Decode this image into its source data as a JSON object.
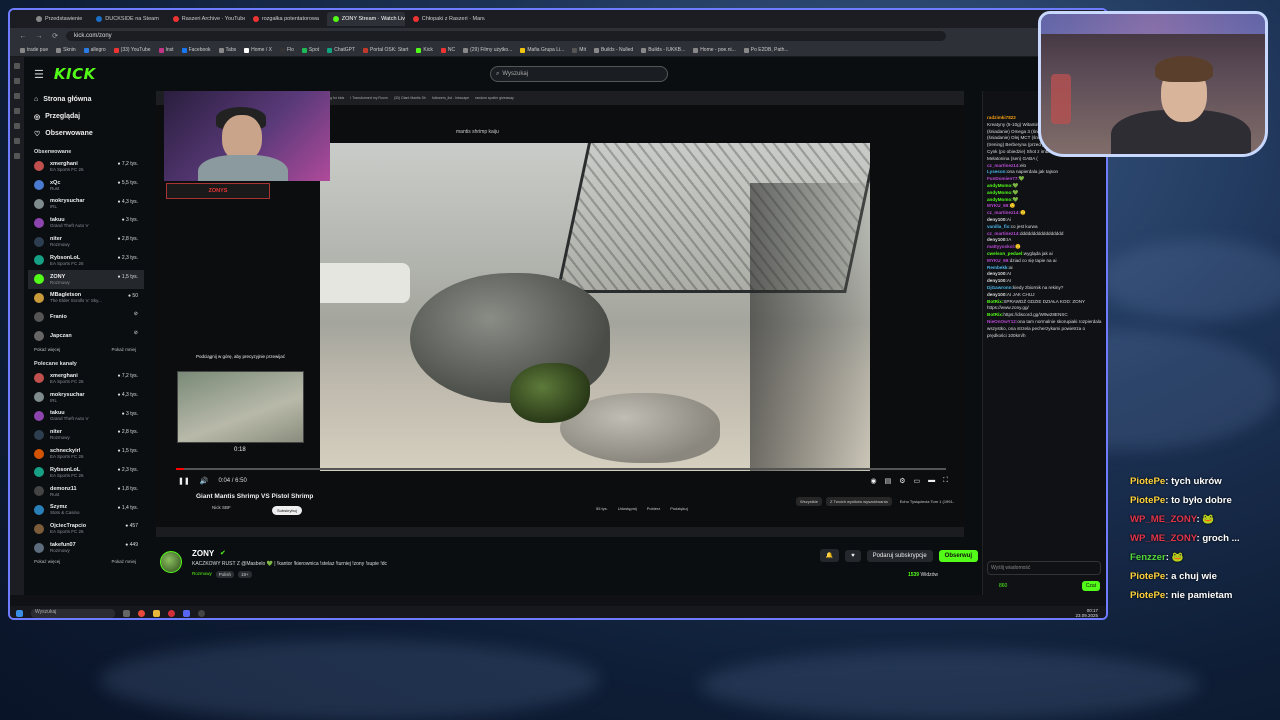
{
  "browser": {
    "tabs": [
      "Przedstawienie",
      "DUCKSIDE na Steam",
      "Raszeri Archive · YouTube",
      "rozgałka potentatorowa",
      "ZONY Stream · Watch Live",
      "Chłopaki z Raszeri · Manua"
    ],
    "url": "kick.com/zony",
    "bookmarks": [
      "trade pue",
      "Sknin",
      "allegro",
      "(33) YouTube",
      "Inst",
      "Facebook",
      "Tabs",
      "Home / X",
      "Flo",
      "Spot",
      "ChatGPT",
      "Portal OSK: Start",
      "Kick",
      "NC",
      "(29) Filmy użytko...",
      "Mafia Grupa Li...",
      "Mit",
      "Builds - Nulled",
      "Builds - lUKKB...",
      "Home - poe.ni...",
      "Po E2DB, Path..."
    ]
  },
  "kick": {
    "logo": "KICK",
    "search_placeholder": "Wyszukaj",
    "nav": [
      {
        "label": "Strona główna",
        "icon": "home-icon"
      },
      {
        "label": "Przeglądaj",
        "icon": "compass-icon"
      },
      {
        "label": "Obserwowane",
        "icon": "heart-icon"
      }
    ],
    "followed_heading": "Obserwowane",
    "followed": [
      {
        "name": "xmerghani",
        "game": "EA Sports FC 26",
        "viewers": "7,2 tys.",
        "color": "#c0504d"
      },
      {
        "name": "xQc",
        "game": "Rust",
        "viewers": "5,5 tys.",
        "color": "#4a7bd0"
      },
      {
        "name": "mokrysuchar",
        "game": "IRL",
        "viewers": "4,3 tys.",
        "color": "#7f8c8d"
      },
      {
        "name": "takuu",
        "game": "Grand Theft Auto V",
        "viewers": "3 tys.",
        "color": "#8e44ad"
      },
      {
        "name": "niter",
        "game": "Rozmowy",
        "viewers": "2,8 tys.",
        "color": "#2c3e50"
      },
      {
        "name": "RybsonLoL",
        "game": "EA Sports FC 26",
        "viewers": "2,3 tys.",
        "color": "#16a085"
      },
      {
        "name": "ZONY",
        "game": "Rozmowy",
        "viewers": "1,5 tys.",
        "color": "#53fc18"
      },
      {
        "name": "MBagletson",
        "game": "The Elder Scrolls V: Sky...",
        "viewers": "50",
        "color": "#c89a3a"
      },
      {
        "name": "Franio",
        "game": "",
        "viewers": "",
        "color": "#555"
      },
      {
        "name": "Japczan",
        "game": "",
        "viewers": "",
        "color": "#666"
      }
    ],
    "show_more": "Pokaż więcej",
    "show_less": "Pokaż mniej",
    "recommended_heading": "Polecane kanały",
    "recommended": [
      {
        "name": "xmerghani",
        "game": "EA Sports FC 26",
        "viewers": "7,2 tys.",
        "color": "#c0504d"
      },
      {
        "name": "mokrysuchar",
        "game": "IRL",
        "viewers": "4,3 tys.",
        "color": "#7f8c8d"
      },
      {
        "name": "takuu",
        "game": "Grand Theft Auto V",
        "viewers": "3 tys.",
        "color": "#8e44ad"
      },
      {
        "name": "niter",
        "game": "Rozmowy",
        "viewers": "2,8 tys.",
        "color": "#2c3e50"
      },
      {
        "name": "schneckyirl",
        "game": "EA Sports FC 26",
        "viewers": "1,5 tys.",
        "color": "#d35400"
      },
      {
        "name": "RybsonLoL",
        "game": "EA Sports FC 26",
        "viewers": "2,3 tys.",
        "color": "#16a085"
      },
      {
        "name": "demonz11",
        "game": "Rust",
        "viewers": "1,8 tys.",
        "color": "#444"
      },
      {
        "name": "Szymz",
        "game": "Slots & Casino",
        "viewers": "1,4 tys.",
        "color": "#2980b9"
      },
      {
        "name": "OjciecTrapcio",
        "game": "EA Sports FC 26",
        "viewers": "457",
        "color": "#7b5b3a"
      },
      {
        "name": "takefun07",
        "game": "Rozmowy",
        "viewers": "449",
        "color": "#5d6d7e"
      }
    ]
  },
  "player": {
    "yt_search": "mantis shrimp kaiju",
    "pip_text": "Podciągnij w górę, aby precyzyjnie przewijać",
    "pip_time": "0:18",
    "time": "0:04 / 6:50",
    "progress": 0.01,
    "video_title": "Giant Mantis Shrimp VS Pistol Shrimp",
    "channel": "Nick SBF",
    "subscribe": "Subskrybuj",
    "actions": [
      "55 tys.",
      "Udostępnij",
      "Pobierz",
      "Podziękuj"
    ],
    "side_chips": [
      "Wszystkie",
      "Z Twoich wyników wyszukiwania"
    ],
    "side_video": "Echo Tysiąclecia Tom 1 (1991-"
  },
  "webcam_badge": "ZONYS",
  "stream": {
    "name": "ZONY",
    "title": "KACZKOWY RUST Z @Masbelo 💚 | !kantor !kierownica !stelaz !turniej !zony !supie !dc",
    "category": "Rozmowy",
    "tags": [
      "Polish",
      "18+"
    ],
    "gift_label": "Podaruj subskrypcje",
    "follow_label": "Obserwuj",
    "viewers": "1539",
    "viewers_label": "Widzów"
  },
  "chat": {
    "messages": [
      {
        "user": "radzimki7822",
        "color": "#f39c12",
        "text": ""
      },
      {
        "user": "",
        "color": "#ddd",
        "text": "Kreatyny (5-10g) Witamina D3 Witamina ADEK (śniadanie) Omega 3 (śniadanie) Ashwagandha (śniadanie) Olej MCT (śniadanie) EAA + Vitargo (trening) Berberyna (przed posiłkami) B-complex (obiad) Cynk (po obiedzie) Shot z imbirem i kurkumą (po kolacji) Melatonina (sen) GABA ("
      },
      {
        "user": "cz_martinez14:",
        "color": "#b94ad4",
        "text": "elo"
      },
      {
        "user": "Lyseson:",
        "color": "#4ab3e6",
        "text": "ona napierdala jak tajson"
      },
      {
        "user": "FunDomien77:",
        "color": "#b94ad4",
        "text": "💚"
      },
      {
        "user": "andyMomo:",
        "color": "#53fc18",
        "text": "💚"
      },
      {
        "user": "andyMomo:",
        "color": "#53fc18",
        "text": "💚"
      },
      {
        "user": "andyMomo:",
        "color": "#53fc18",
        "text": "💚"
      },
      {
        "user": "MYKU_69:",
        "color": "#b94ad4",
        "text": "🙂"
      },
      {
        "user": "cz_martinez14:",
        "color": "#b94ad4",
        "text": "🙂"
      },
      {
        "user": "deny100:",
        "color": "#ddd",
        "text": "Ai"
      },
      {
        "user": "vanilla_fix:",
        "color": "#4ab3e6",
        "text": "co jest kurwa"
      },
      {
        "user": "cz_martinez14:",
        "color": "#b94ad4",
        "text": "ddddddddddddddddd"
      },
      {
        "user": "deny100:",
        "color": "#ddd",
        "text": "IA"
      },
      {
        "user": "mattyyoskol:",
        "color": "#b94ad4",
        "text": "🙂"
      },
      {
        "user": "cwelson_pedael:",
        "color": "#53fc18",
        "text": "wygląda jak ai"
      },
      {
        "user": "MYKU_69:",
        "color": "#b94ad4",
        "text": "dziad co się tapie na ai"
      },
      {
        "user": "Rembekk:",
        "color": "#4ab3e6",
        "text": "ai"
      },
      {
        "user": "deny100:",
        "color": "#ddd",
        "text": "AI"
      },
      {
        "user": "deny100:",
        "color": "#ddd",
        "text": "AI"
      },
      {
        "user": "DjGawronn:",
        "color": "#4ab3e6",
        "text": "kiedy zbiornik na rekiny?"
      },
      {
        "user": "deny100:",
        "color": "#ddd",
        "text": "AI JAK CHUJ"
      },
      {
        "user": "BotRix:",
        "color": "#53fc18",
        "text": "SPRAWDŹ GDZIE DZIAŁA KOD: ZONY https://www.zony.gg/"
      },
      {
        "user": "BotRix:",
        "color": "#53fc18",
        "text": "https://discord.gg/W9w28ENSC"
      },
      {
        "user": "NieOnOwY12:",
        "color": "#b94ad4",
        "text": "ona tam normalnie skorupiaki rozpierdala wszystko, ona strzela pecherzykami powietrza o prędkości 100km/h"
      }
    ],
    "input_placeholder": "Wyślij wiadomość",
    "send_label": "Czat",
    "points": "860"
  },
  "taskbar": {
    "search": "Wyszukaj",
    "time": "00:17",
    "date": "23.09.2025"
  },
  "overlay_chat": [
    {
      "user": "PiotePe",
      "color": "yellow",
      "text": ": tych ukrów"
    },
    {
      "user": "PiotePe",
      "color": "yellow",
      "text": ": to było dobre"
    },
    {
      "user": "WP_ME_ZONY",
      "color": "red",
      "text": ": 🐸"
    },
    {
      "user": "WP_ME_ZONY",
      "color": "red",
      "text": ": groch ..."
    },
    {
      "user": "Fenzzer",
      "color": "green",
      "text": ": 🐸"
    },
    {
      "user": "PiotePe",
      "color": "yellow",
      "text": ": a chuj wie"
    },
    {
      "user": "PiotePe",
      "color": "yellow",
      "text": ": nie pamietam"
    }
  ]
}
